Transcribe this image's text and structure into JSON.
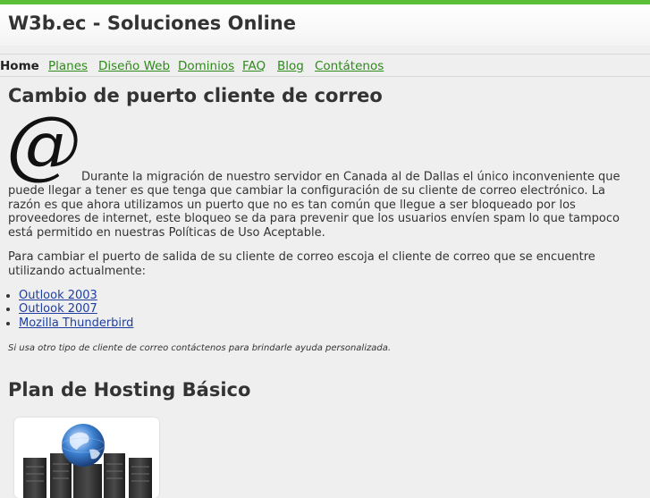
{
  "site": {
    "title": "W3b.ec - Soluciones Online"
  },
  "nav": {
    "items": [
      {
        "label": "Home",
        "active": true
      },
      {
        "label": "Planes",
        "active": false
      },
      {
        "label": "Diseño Web",
        "active": false
      },
      {
        "label": "Dominios",
        "active": false
      },
      {
        "label": "FAQ",
        "active": false
      },
      {
        "label": "Blog",
        "active": false
      },
      {
        "label": "Contátenos",
        "active": false
      }
    ]
  },
  "article": {
    "title": "Cambio de puerto cliente de correo",
    "icon": "at-sign-icon",
    "intro": "Durante la migración de nuestro servidor en Canada al de Dallas el único inconveniente que puede llegar a tener es que tenga que cambiar la configuración de su cliente de correo electrónico. La razón es que ahora utilizamos un puerto que no es tan común que llegue a ser bloqueado por los proveedores de internet, este bloqueo se da para prevenir que los usuarios envíen spam lo que tampoco está permitido en nuestras Políticas de Uso Aceptable.",
    "instructions": "Para cambiar el puerto de salida de su cliente de correo escoja el cliente de correo que se encuentre utilizando actualmente:",
    "clients": [
      "Outlook 2003",
      "Outlook 2007",
      "Mozilla Thunderbird"
    ],
    "note": "Si usa otro tipo de cliente de correo contáctenos para brindarle ayuda personalizada."
  },
  "hosting": {
    "title": "Plan de Hosting Básico",
    "image": "server-globe-icon"
  },
  "colors": {
    "accent_green": "#5cbf3a",
    "nav_link": "#2e8a1a",
    "content_link": "#1f3fa0",
    "background": "#efefef"
  }
}
